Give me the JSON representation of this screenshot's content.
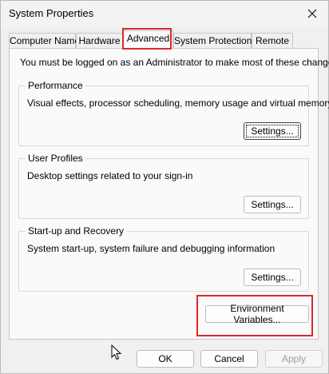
{
  "window": {
    "title": "System Properties"
  },
  "tabs": [
    {
      "label": "Computer Name"
    },
    {
      "label": "Hardware"
    },
    {
      "label": "Advanced"
    },
    {
      "label": "System Protection"
    },
    {
      "label": "Remote"
    }
  ],
  "active_tab": "Advanced",
  "notice": "You must be logged on as an Administrator to make most of these changes.",
  "groups": {
    "performance": {
      "label": "Performance",
      "description": "Visual effects, processor scheduling, memory usage and virtual memory",
      "button": "Settings..."
    },
    "user_profiles": {
      "label": "User Profiles",
      "description": "Desktop settings related to your sign-in",
      "button": "Settings..."
    },
    "startup_recovery": {
      "label": "Start-up and Recovery",
      "description": "System start-up, system failure and debugging information",
      "button": "Settings..."
    }
  },
  "env_button": "Environment Variables...",
  "footer": {
    "ok": "OK",
    "cancel": "Cancel",
    "apply": "Apply"
  },
  "colors": {
    "highlight": "#d62b2b",
    "panel": "#fafafa",
    "window": "#f0f0f0"
  }
}
